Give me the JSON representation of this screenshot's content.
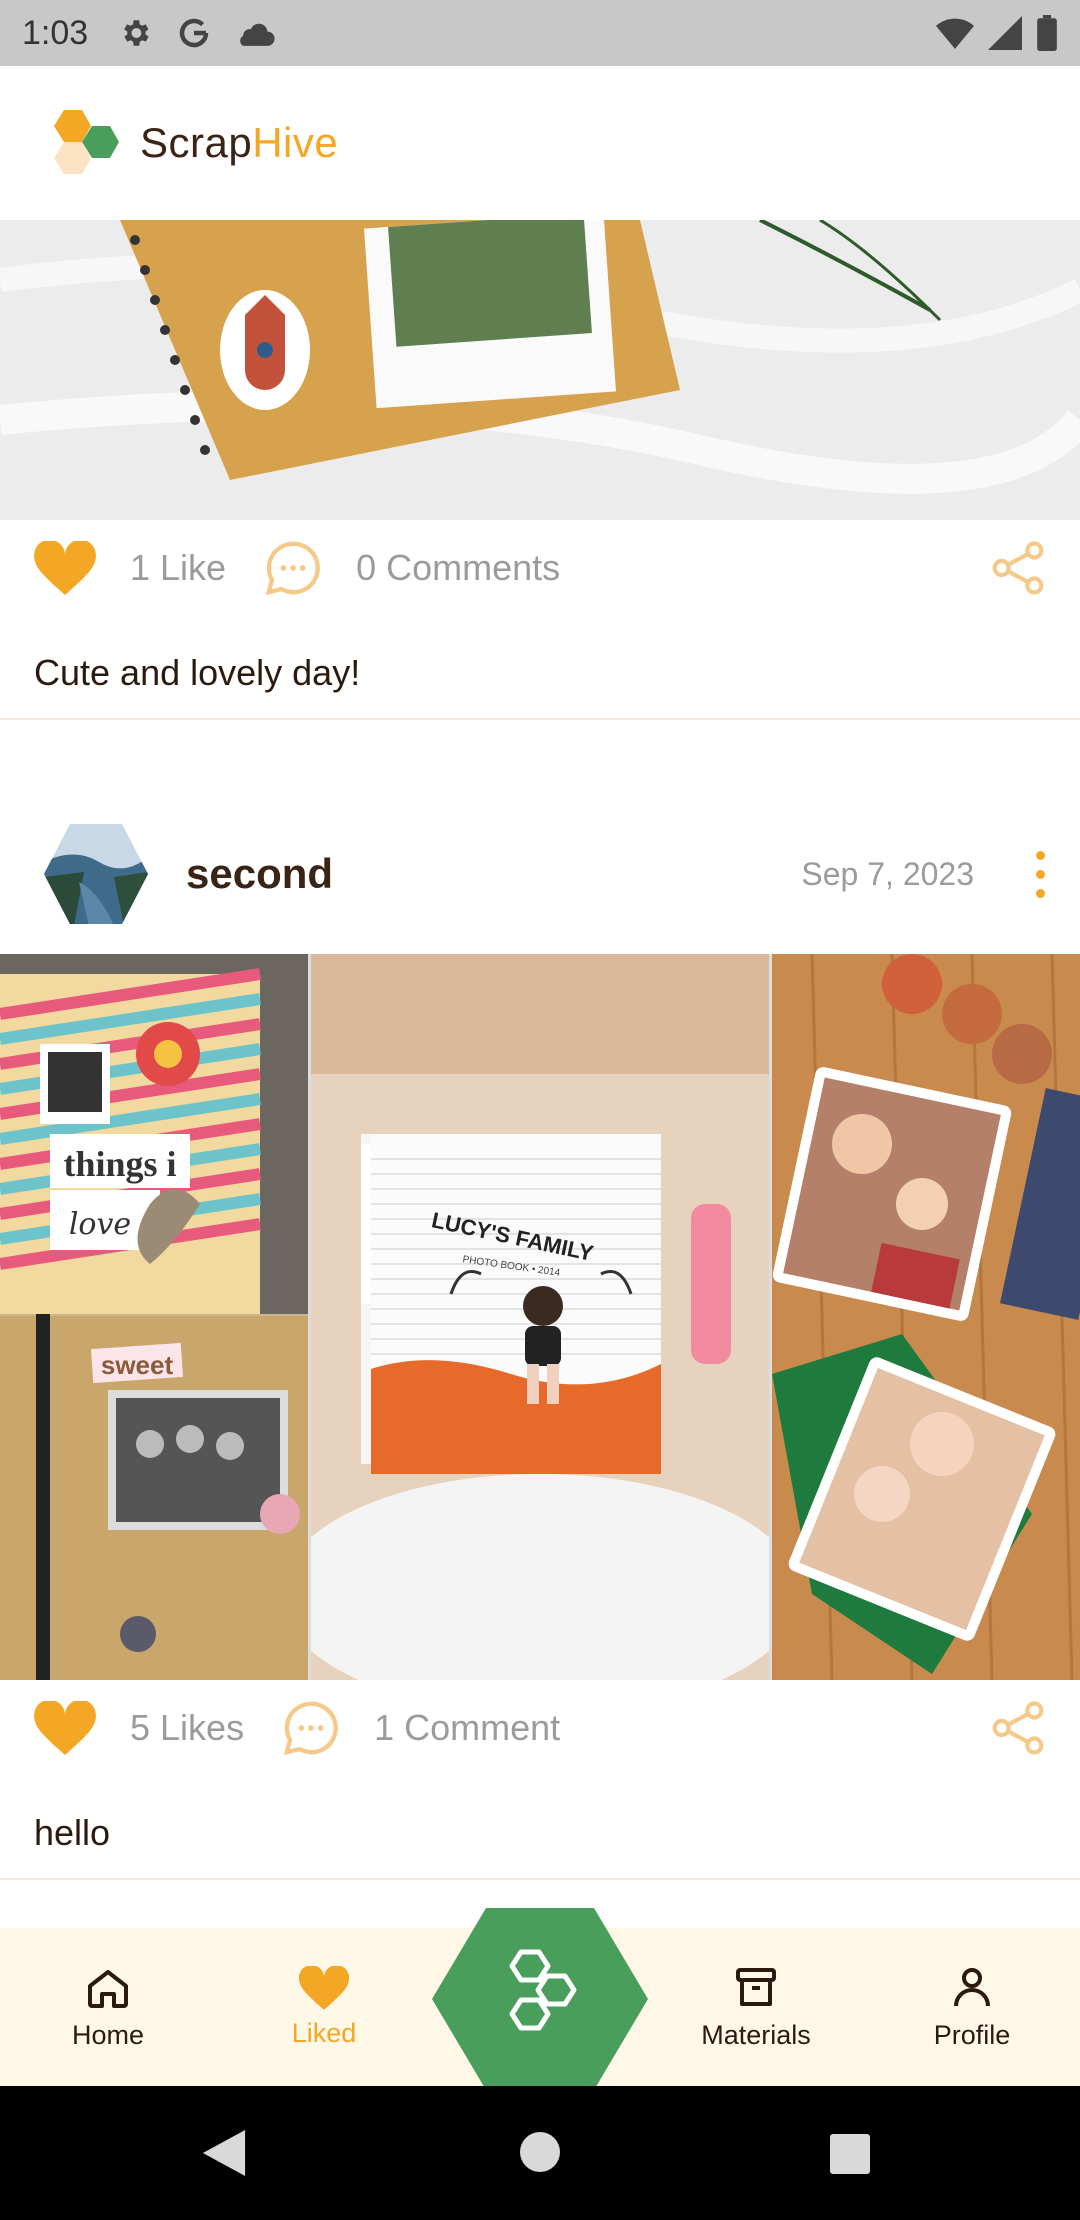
{
  "status_bar": {
    "time": "1:03",
    "icons_left": [
      "settings-icon",
      "google-icon",
      "cloud-icon"
    ],
    "icons_right": [
      "wifi-icon",
      "signal-icon",
      "battery-icon"
    ]
  },
  "app": {
    "name_part1": "Scrap",
    "name_part2": "Hive",
    "brand_colors": {
      "orange": "#f3a724",
      "green": "#4a9e5c",
      "dark": "#3a2415"
    }
  },
  "posts": [
    {
      "likes_label": "1 Like",
      "comments_label": "0 Comments",
      "caption": "Cute and lovely day!"
    },
    {
      "username": "second",
      "date": "Sep 7, 2023",
      "gallery_labels": [
        "things i",
        "love",
        "sweet",
        "LUCY'S FAMILY",
        "PHOTO BOOK • 2014"
      ],
      "likes_label": "5 Likes",
      "comments_label": "1 Comment",
      "caption": "hello"
    }
  ],
  "bottom_nav": {
    "items": [
      {
        "label": "Home",
        "icon": "home-icon"
      },
      {
        "label": "Liked",
        "icon": "heart-icon"
      },
      {
        "label": "",
        "icon": "hive-icon"
      },
      {
        "label": "Materials",
        "icon": "archive-icon"
      },
      {
        "label": "Profile",
        "icon": "person-icon"
      }
    ],
    "active": "Liked"
  },
  "system_nav": [
    "back-icon",
    "home-circle-icon",
    "recents-icon"
  ]
}
